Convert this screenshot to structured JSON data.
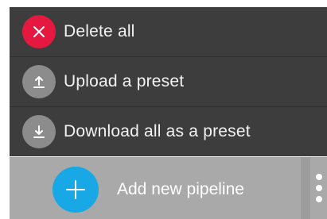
{
  "menu": {
    "items": [
      {
        "label": "Delete all",
        "icon": "close-icon",
        "icon_bg": "#e5193f"
      },
      {
        "label": "Upload a preset",
        "icon": "upload-icon",
        "icon_bg": "#8c8c8c"
      },
      {
        "label": "Download all as a preset",
        "icon": "download-icon",
        "icon_bg": "#8c8c8c"
      }
    ]
  },
  "bottom_bar": {
    "add_label": "Add new pipeline",
    "add_icon": "plus-icon",
    "add_color": "#19a8e6",
    "more_icon": "more-vertical-icon"
  }
}
